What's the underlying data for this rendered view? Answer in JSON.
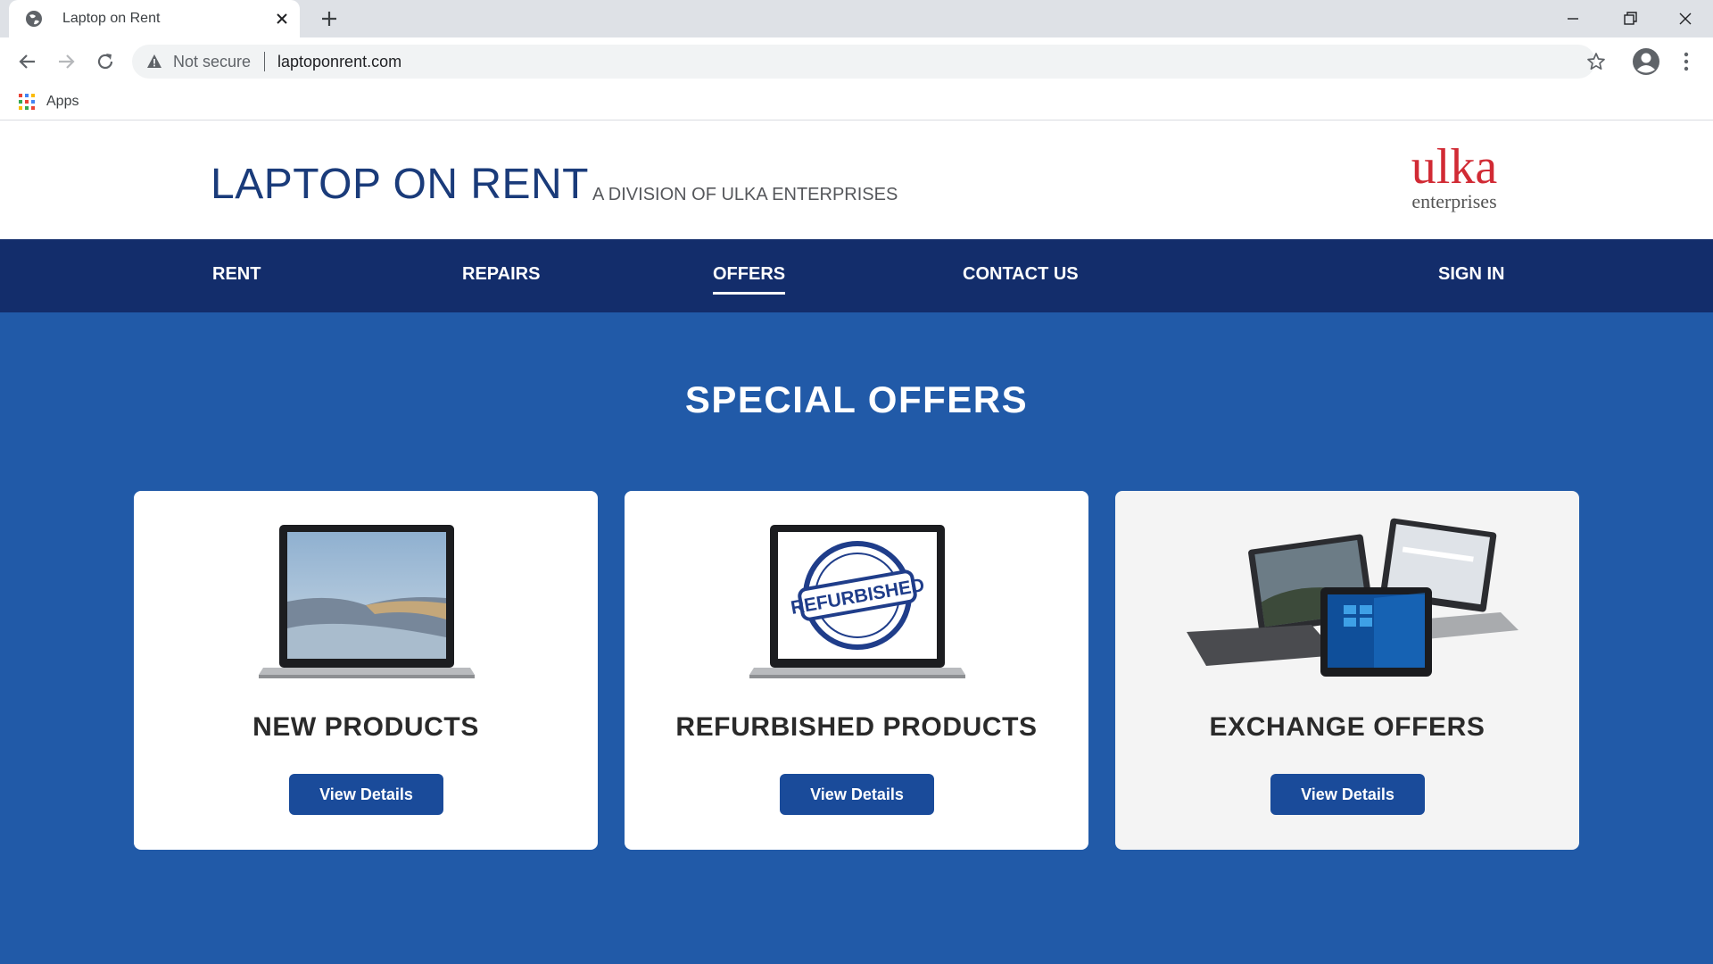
{
  "browser": {
    "tab_title": "Laptop on Rent",
    "omnibox": {
      "security_label": "Not secure",
      "url": "laptoponrent.com"
    },
    "bookmarks_bar": {
      "apps_label": "Apps"
    }
  },
  "site": {
    "title": "LAPTOP ON RENT",
    "subtitle": "A DIVISION OF ULKA ENTERPRISES",
    "logo": {
      "brand": "ulka",
      "tagline": "enterprises",
      "brand_color": "#d12a34"
    },
    "nav": {
      "items": [
        {
          "label": "RENT"
        },
        {
          "label": "REPAIRS"
        },
        {
          "label": "OFFERS",
          "active": true
        },
        {
          "label": "CONTACT US"
        }
      ],
      "sign_in": "SIGN IN"
    },
    "offers": {
      "title": "SPECIAL OFFERS",
      "cards": [
        {
          "title": "NEW PRODUCTS",
          "button": "View Details",
          "image": "laptop-landscape-screen"
        },
        {
          "title": "REFURBISHED PRODUCTS",
          "button": "View Details",
          "image": "laptop-refurbished-stamp",
          "stamp_text": "REFURBISHED"
        },
        {
          "title": "EXCHANGE OFFERS",
          "button": "View Details",
          "image": "multiple-laptops-and-tablets"
        }
      ]
    }
  },
  "colors": {
    "nav_bg": "#132d6b",
    "offers_bg": "#215aa8",
    "button_bg": "#1a4b9a",
    "title_blue": "#1a3b7a"
  }
}
